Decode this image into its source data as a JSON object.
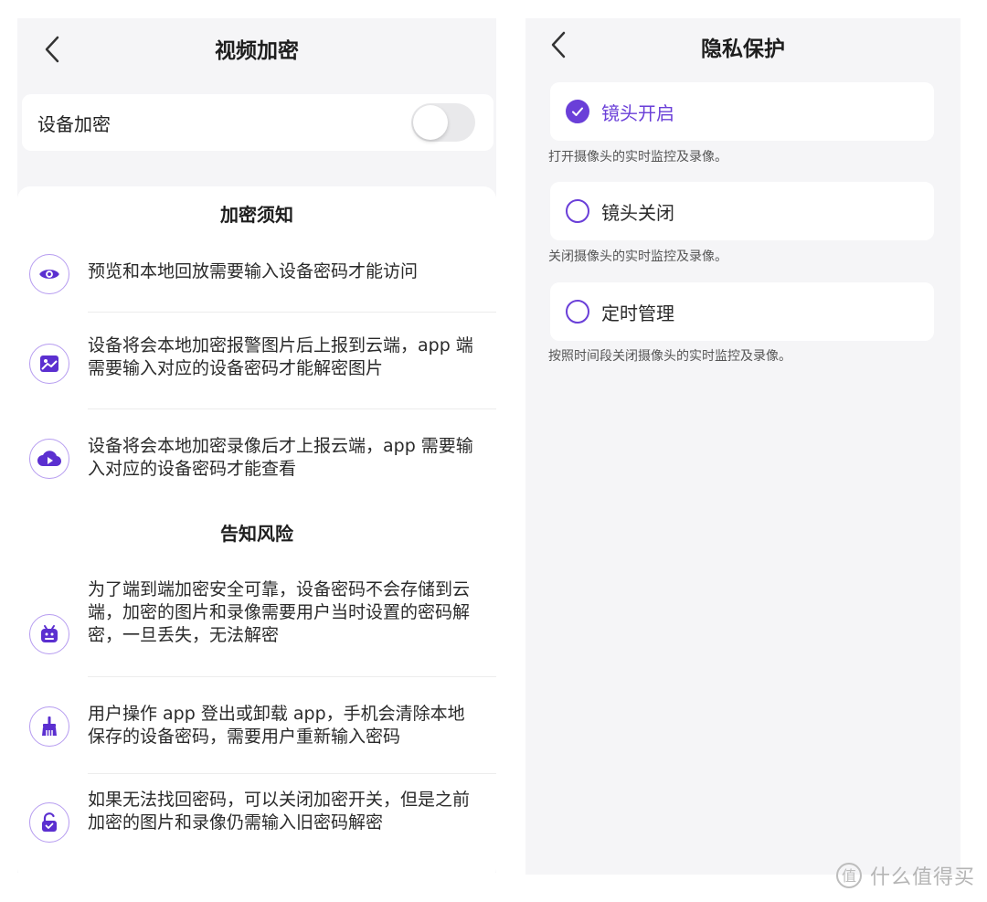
{
  "left": {
    "title": "视频加密",
    "switch": {
      "label": "设备加密",
      "enabled": false
    },
    "section1_title": "加密须知",
    "section1_items": [
      {
        "icon": "eye-icon",
        "text": "预览和本地回放需要输入设备密码才能访问"
      },
      {
        "icon": "image-icon",
        "text": "设备将会本地加密报警图片后上报到云端，app 端需要输入对应的设备密码才能解密图片"
      },
      {
        "icon": "cloud-play-icon",
        "text": "设备将会本地加密录像后才上报云端，app 需要输入对应的设备密码才能查看"
      }
    ],
    "section2_title": "告知风险",
    "section2_items": [
      {
        "icon": "android-icon",
        "text": "为了端到端加密安全可靠，设备密码不会存储到云端，加密的图片和录像需要用户当时设置的密码解密，一旦丢失，无法解密"
      },
      {
        "icon": "broom-icon",
        "text": "用户操作 app 登出或卸载 app，手机会清除本地保存的设备密码，需要用户重新输入密码"
      },
      {
        "icon": "unlock-icon",
        "text": "如果无法找回密码，可以关闭加密开关，但是之前加密的图片和录像仍需输入旧密码解密"
      }
    ]
  },
  "right": {
    "title": "隐私保护",
    "options": [
      {
        "label": "镜头开启",
        "desc": "打开摄像头的实时监控及录像。",
        "selected": true
      },
      {
        "label": "镜头关闭",
        "desc": "关闭摄像头的实时监控及录像。",
        "selected": false
      },
      {
        "label": "定时管理",
        "desc": "按照时间段关闭摄像头的实时监控及录像。",
        "selected": false
      }
    ]
  },
  "watermark": {
    "text": "什么值得买",
    "icon": "smzdm-logo-icon"
  },
  "colors": {
    "accent": "#6a3fd8",
    "icon_border": "#b69cf0",
    "panel_bg": "#f5f5f7"
  }
}
